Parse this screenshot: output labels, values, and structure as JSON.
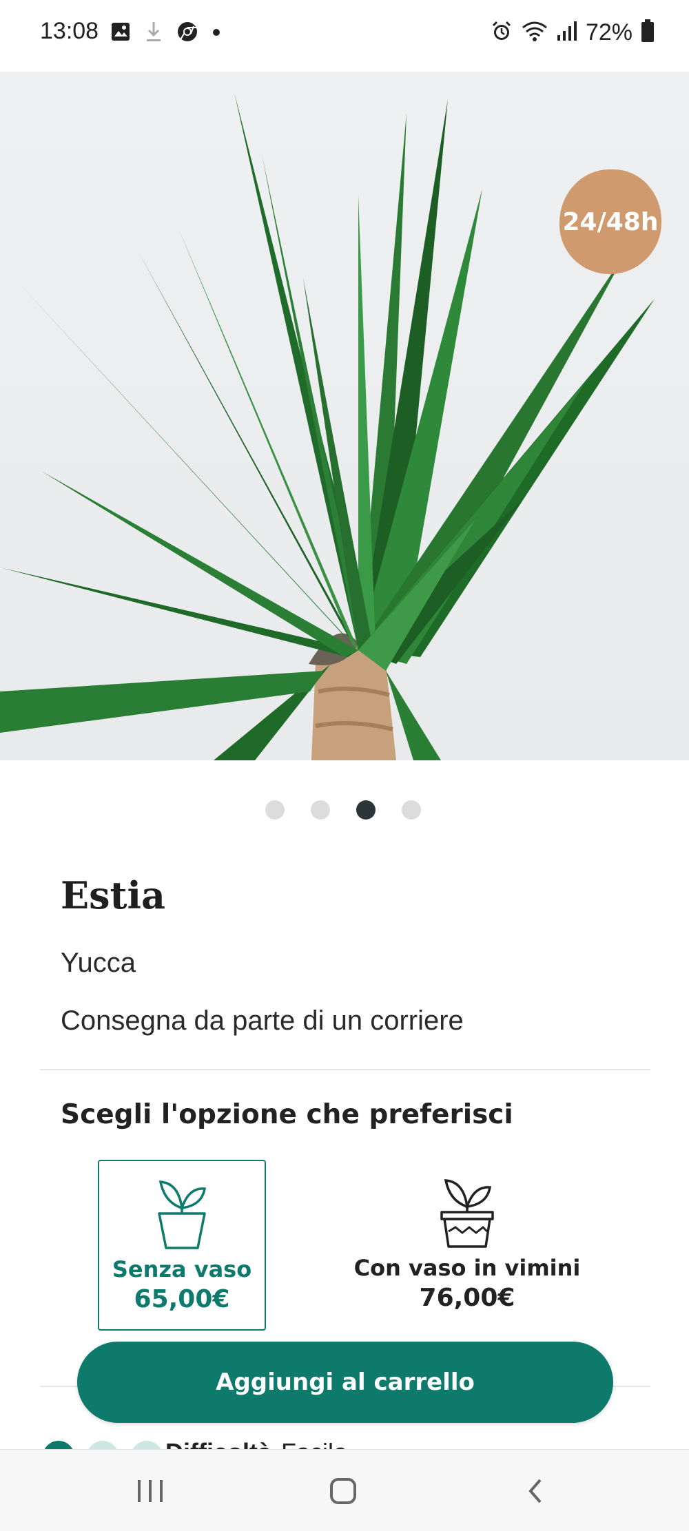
{
  "status_bar": {
    "time": "13:08",
    "battery": "72%",
    "left_icons": [
      "image-icon",
      "download-icon",
      "chrome-icon",
      "dot-icon"
    ],
    "right_icons": [
      "alarm-icon",
      "wifi-icon",
      "signal-icon",
      "battery-icon"
    ]
  },
  "hero": {
    "badge": "24/48h",
    "badge_color": "#cf9a6e"
  },
  "carousel": {
    "total": 4,
    "active_index": 3
  },
  "product": {
    "name": "Estia",
    "species": "Yucca",
    "delivery": "Consegna da parte di un corriere"
  },
  "options": {
    "title": "Scegli l'opzione che preferisci",
    "items": [
      {
        "label": "Senza vaso",
        "price": "65,00€",
        "selected": true,
        "icon": "plant-pot-icon"
      },
      {
        "label": "Con vaso in vimini",
        "price": "76,00€",
        "selected": false,
        "icon": "wicker-pot-plant-icon"
      }
    ]
  },
  "cart": {
    "button_label": "Aggiungi al carrello"
  },
  "difficulty": {
    "label": "Difficoltà",
    "value": "Facile"
  },
  "colors": {
    "accent": "#0e7a6b",
    "badge": "#cf9a6e"
  },
  "nav_bar": {
    "items": [
      "recent-apps-icon",
      "home-icon",
      "back-icon"
    ]
  }
}
